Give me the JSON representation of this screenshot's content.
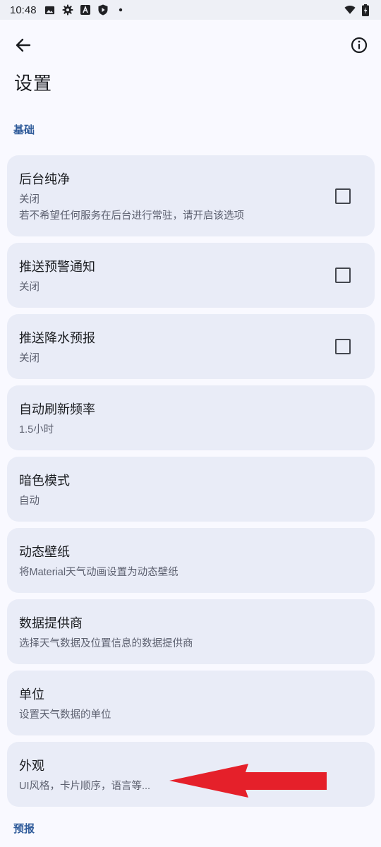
{
  "status_bar": {
    "time": "10:48"
  },
  "app_bar": {
    "title": "设置"
  },
  "sections": {
    "basic": "基础",
    "forecast": "预报"
  },
  "settings": {
    "background_clean": {
      "title": "后台纯净",
      "summary": "关闭",
      "description": "若不希望任何服务在后台进行常驻，请开启该选项",
      "checked": false
    },
    "push_alert": {
      "title": "推送预警通知",
      "summary": "关闭",
      "checked": false
    },
    "push_precipitation": {
      "title": "推送降水预报",
      "summary": "关闭",
      "checked": false
    },
    "refresh_rate": {
      "title": "自动刷新频率",
      "summary": "1.5小时"
    },
    "dark_mode": {
      "title": "暗色模式",
      "summary": "自动"
    },
    "live_wallpaper": {
      "title": "动态壁纸",
      "summary": "将Material天气动画设置为动态壁纸"
    },
    "data_provider": {
      "title": "数据提供商",
      "summary": "选择天气数据及位置信息的数据提供商"
    },
    "units": {
      "title": "单位",
      "summary": "设置天气数据的单位"
    },
    "appearance": {
      "title": "外观",
      "summary": "UI风格，卡片顺序，语言等..."
    }
  },
  "colors": {
    "accent": "#2f5b9a",
    "card_background": "#e9ecf7",
    "annotation_arrow": "#e5202a"
  }
}
